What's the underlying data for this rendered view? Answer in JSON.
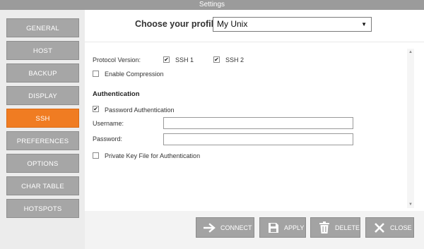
{
  "window": {
    "title": "Settings"
  },
  "sidebar": {
    "items": [
      {
        "label": "GENERAL",
        "active": false
      },
      {
        "label": "HOST",
        "active": false
      },
      {
        "label": "BACKUP",
        "active": false
      },
      {
        "label": "DISPLAY",
        "active": false
      },
      {
        "label": "SSH",
        "active": true
      },
      {
        "label": "PREFERENCES",
        "active": false
      },
      {
        "label": "OPTIONS",
        "active": false
      },
      {
        "label": "CHAR TABLE",
        "active": false
      },
      {
        "label": "HOTSPOTS",
        "active": false
      }
    ]
  },
  "profile": {
    "label": "Choose your profile:",
    "selected": "My Unix",
    "caret": "▼"
  },
  "ssh": {
    "protocol_label": "Protocol Version:",
    "ssh1": {
      "label": "SSH 1",
      "checked": true
    },
    "ssh2": {
      "label": "SSH 2",
      "checked": true
    },
    "compression": {
      "label": "Enable Compression",
      "checked": false
    },
    "auth_header": "Authentication",
    "password_auth": {
      "label": "Password Authentication",
      "checked": true
    },
    "username_label": "Username:",
    "username_value": "",
    "password_label": "Password:",
    "password_value": "",
    "private_key": {
      "label": "Private Key File for Authentication",
      "checked": false
    }
  },
  "actions": {
    "connect": "CONNECT",
    "apply": "APPLY",
    "delete": "DELETE",
    "close": "CLOSE"
  },
  "icons": {
    "connect": "arrow-right-icon",
    "apply": "floppy-disk-icon",
    "delete": "trash-icon",
    "close": "x-icon"
  },
  "colors": {
    "active_tab": "#f07c22",
    "button": "#a6a6a6",
    "titlebar": "#9b9b9b"
  }
}
